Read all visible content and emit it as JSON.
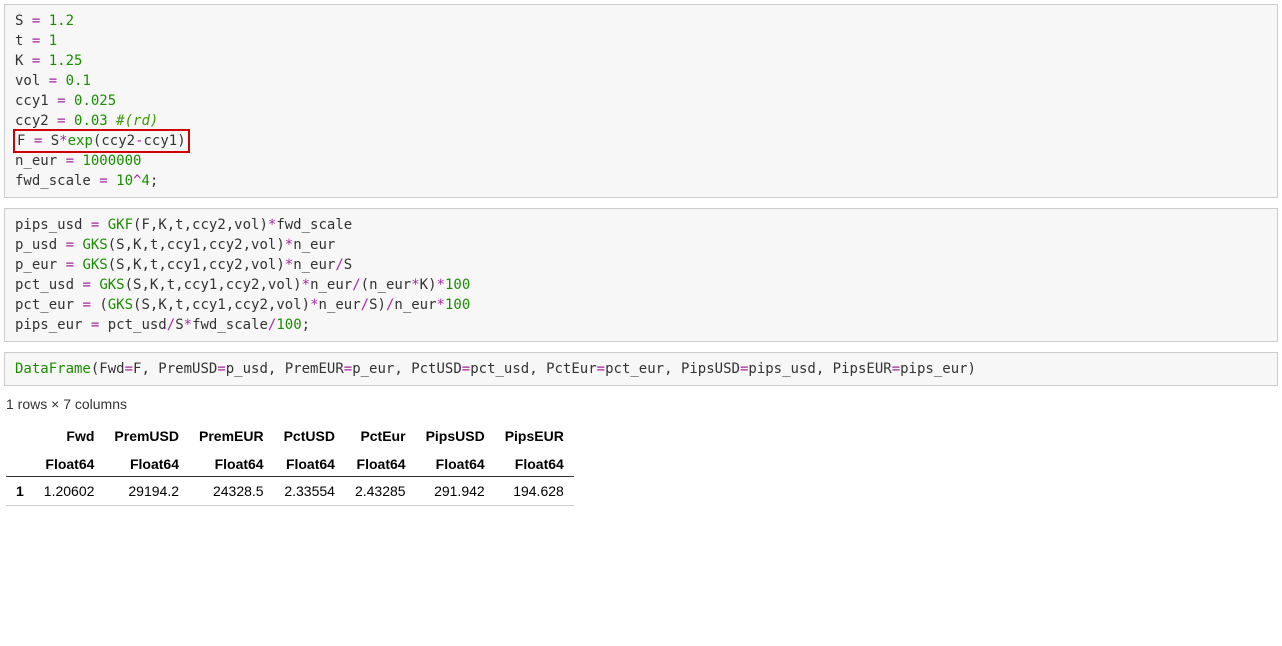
{
  "cells": {
    "cell1": {
      "lines": [
        [
          {
            "t": "S",
            "c": "tok-var"
          },
          {
            "t": " = ",
            "c": "tok-op"
          },
          {
            "t": "1.2",
            "c": "tok-num"
          }
        ],
        [
          {
            "t": "t",
            "c": "tok-var"
          },
          {
            "t": " = ",
            "c": "tok-op"
          },
          {
            "t": "1",
            "c": "tok-num"
          }
        ],
        [
          {
            "t": "K",
            "c": "tok-var"
          },
          {
            "t": " = ",
            "c": "tok-op"
          },
          {
            "t": "1.25",
            "c": "tok-num"
          }
        ],
        [
          {
            "t": "vol",
            "c": "tok-var"
          },
          {
            "t": " = ",
            "c": "tok-op"
          },
          {
            "t": "0.1",
            "c": "tok-num"
          }
        ],
        [
          {
            "t": "ccy1",
            "c": "tok-var"
          },
          {
            "t": " = ",
            "c": "tok-op"
          },
          {
            "t": "0.025",
            "c": "tok-num"
          }
        ],
        [
          {
            "t": "ccy2",
            "c": "tok-var"
          },
          {
            "t": " = ",
            "c": "tok-op"
          },
          {
            "t": "0.03",
            "c": "tok-num"
          },
          {
            "t": " #(rd)",
            "c": "tok-comment"
          }
        ],
        [
          {
            "t": "F",
            "c": "tok-var"
          },
          {
            "t": " = ",
            "c": "tok-op"
          },
          {
            "t": "S",
            "c": "tok-var"
          },
          {
            "t": "*",
            "c": "tok-op"
          },
          {
            "t": "exp",
            "c": "tok-fn"
          },
          {
            "t": "(",
            "c": "tok-var"
          },
          {
            "t": "ccy2",
            "c": "tok-var"
          },
          {
            "t": "-",
            "c": "tok-op"
          },
          {
            "t": "ccy1",
            "c": "tok-var"
          },
          {
            "t": ")",
            "c": "tok-var"
          }
        ],
        [
          {
            "t": "n_eur",
            "c": "tok-var"
          },
          {
            "t": " = ",
            "c": "tok-op"
          },
          {
            "t": "1000000",
            "c": "tok-num"
          }
        ],
        [
          {
            "t": "fwd_scale",
            "c": "tok-var"
          },
          {
            "t": " = ",
            "c": "tok-op"
          },
          {
            "t": "10",
            "c": "tok-num"
          },
          {
            "t": "^",
            "c": "tok-op"
          },
          {
            "t": "4",
            "c": "tok-num"
          },
          {
            "t": ";",
            "c": "tok-var"
          }
        ]
      ],
      "highlight_line": 6
    },
    "cell2": {
      "lines": [
        [
          {
            "t": "pips_usd",
            "c": "tok-var"
          },
          {
            "t": " = ",
            "c": "tok-op"
          },
          {
            "t": "GKF",
            "c": "tok-fn"
          },
          {
            "t": "(F,K,t,ccy2,vol)",
            "c": "tok-var"
          },
          {
            "t": "*",
            "c": "tok-op"
          },
          {
            "t": "fwd_scale",
            "c": "tok-var"
          }
        ],
        [
          {
            "t": "p_usd",
            "c": "tok-var"
          },
          {
            "t": " = ",
            "c": "tok-op"
          },
          {
            "t": "GKS",
            "c": "tok-fn"
          },
          {
            "t": "(S,K,t,ccy1,ccy2,vol)",
            "c": "tok-var"
          },
          {
            "t": "*",
            "c": "tok-op"
          },
          {
            "t": "n_eur",
            "c": "tok-var"
          }
        ],
        [
          {
            "t": "p_eur",
            "c": "tok-var"
          },
          {
            "t": " = ",
            "c": "tok-op"
          },
          {
            "t": "GKS",
            "c": "tok-fn"
          },
          {
            "t": "(S,K,t,ccy1,ccy2,vol)",
            "c": "tok-var"
          },
          {
            "t": "*",
            "c": "tok-op"
          },
          {
            "t": "n_eur",
            "c": "tok-var"
          },
          {
            "t": "/",
            "c": "tok-op"
          },
          {
            "t": "S",
            "c": "tok-var"
          }
        ],
        [
          {
            "t": "pct_usd",
            "c": "tok-var"
          },
          {
            "t": " = ",
            "c": "tok-op"
          },
          {
            "t": "GKS",
            "c": "tok-fn"
          },
          {
            "t": "(S,K,t,ccy1,ccy2,vol)",
            "c": "tok-var"
          },
          {
            "t": "*",
            "c": "tok-op"
          },
          {
            "t": "n_eur",
            "c": "tok-var"
          },
          {
            "t": "/",
            "c": "tok-op"
          },
          {
            "t": "(n_eur",
            "c": "tok-var"
          },
          {
            "t": "*",
            "c": "tok-op"
          },
          {
            "t": "K)",
            "c": "tok-var"
          },
          {
            "t": "*",
            "c": "tok-op"
          },
          {
            "t": "100",
            "c": "tok-num"
          }
        ],
        [
          {
            "t": "pct_eur",
            "c": "tok-var"
          },
          {
            "t": " = ",
            "c": "tok-op"
          },
          {
            "t": "(",
            "c": "tok-var"
          },
          {
            "t": "GKS",
            "c": "tok-fn"
          },
          {
            "t": "(S,K,t,ccy1,ccy2,vol)",
            "c": "tok-var"
          },
          {
            "t": "*",
            "c": "tok-op"
          },
          {
            "t": "n_eur",
            "c": "tok-var"
          },
          {
            "t": "/",
            "c": "tok-op"
          },
          {
            "t": "S)",
            "c": "tok-var"
          },
          {
            "t": "/",
            "c": "tok-op"
          },
          {
            "t": "n_eur",
            "c": "tok-var"
          },
          {
            "t": "*",
            "c": "tok-op"
          },
          {
            "t": "100",
            "c": "tok-num"
          }
        ],
        [
          {
            "t": "pips_eur",
            "c": "tok-var"
          },
          {
            "t": " = ",
            "c": "tok-op"
          },
          {
            "t": "pct_usd",
            "c": "tok-var"
          },
          {
            "t": "/",
            "c": "tok-op"
          },
          {
            "t": "S",
            "c": "tok-var"
          },
          {
            "t": "*",
            "c": "tok-op"
          },
          {
            "t": "fwd_scale",
            "c": "tok-var"
          },
          {
            "t": "/",
            "c": "tok-op"
          },
          {
            "t": "100",
            "c": "tok-num"
          },
          {
            "t": ";",
            "c": "tok-var"
          }
        ]
      ]
    },
    "cell3": {
      "lines": [
        [
          {
            "t": "DataFrame",
            "c": "tok-fn"
          },
          {
            "t": "(Fwd",
            "c": "tok-var"
          },
          {
            "t": "=",
            "c": "tok-op"
          },
          {
            "t": "F, PremUSD",
            "c": "tok-var"
          },
          {
            "t": "=",
            "c": "tok-op"
          },
          {
            "t": "p_usd, PremEUR",
            "c": "tok-var"
          },
          {
            "t": "=",
            "c": "tok-op"
          },
          {
            "t": "p_eur, PctUSD",
            "c": "tok-var"
          },
          {
            "t": "=",
            "c": "tok-op"
          },
          {
            "t": "pct_usd, PctEur",
            "c": "tok-var"
          },
          {
            "t": "=",
            "c": "tok-op"
          },
          {
            "t": "pct_eur, PipsUSD",
            "c": "tok-var"
          },
          {
            "t": "=",
            "c": "tok-op"
          },
          {
            "t": "pips_usd, PipsEUR",
            "c": "tok-var"
          },
          {
            "t": "=",
            "c": "tok-op"
          },
          {
            "t": "pips_eur)",
            "c": "tok-var"
          }
        ]
      ]
    }
  },
  "output": {
    "meta": "1 rows × 7 columns",
    "columns": [
      "Fwd",
      "PremUSD",
      "PremEUR",
      "PctUSD",
      "PctEur",
      "PipsUSD",
      "PipsEUR"
    ],
    "types": [
      "Float64",
      "Float64",
      "Float64",
      "Float64",
      "Float64",
      "Float64",
      "Float64"
    ],
    "rows": [
      {
        "idx": "1",
        "vals": [
          "1.20602",
          "29194.2",
          "24328.5",
          "2.33554",
          "2.43285",
          "291.942",
          "194.628"
        ]
      }
    ]
  },
  "chart_data": {
    "type": "table",
    "title": "DataFrame output",
    "columns": [
      "Fwd",
      "PremUSD",
      "PremEUR",
      "PctUSD",
      "PctEur",
      "PipsUSD",
      "PipsEUR"
    ],
    "column_types": [
      "Float64",
      "Float64",
      "Float64",
      "Float64",
      "Float64",
      "Float64",
      "Float64"
    ],
    "data": [
      [
        1.20602,
        29194.2,
        24328.5,
        2.33554,
        2.43285,
        291.942,
        194.628
      ]
    ]
  }
}
